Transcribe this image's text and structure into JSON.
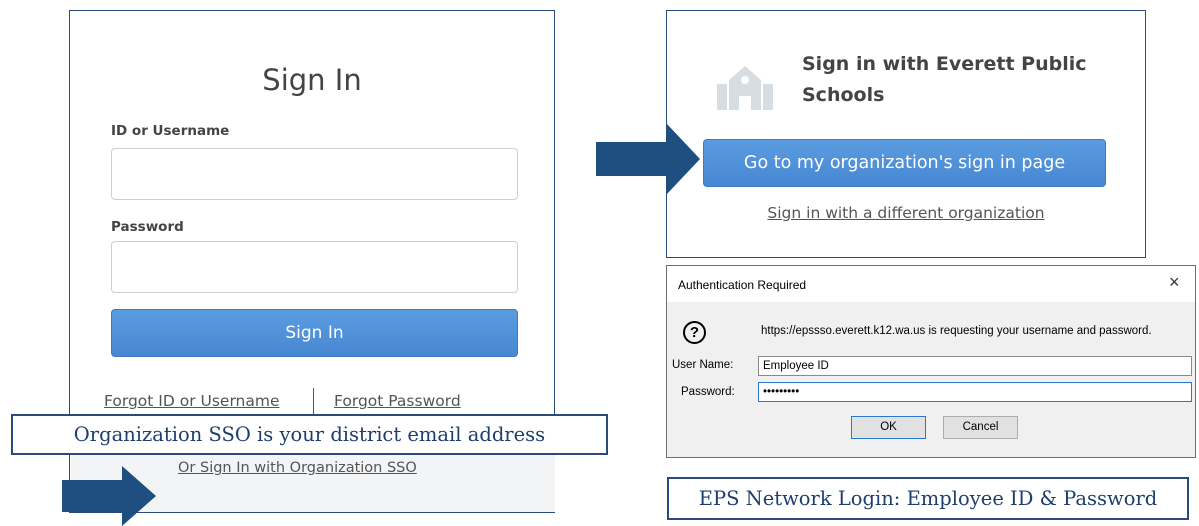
{
  "signin": {
    "title": "Sign In",
    "id_label": "ID or Username",
    "password_label": "Password",
    "button": "Sign In",
    "forgot_id": "Forgot ID or Username",
    "forgot_password": "Forgot Password",
    "sso_link": "Or Sign In with Organization SSO"
  },
  "callouts": {
    "sso": "Organization SSO is your district email address",
    "eps": "EPS Network Login: Employee ID & Password"
  },
  "org": {
    "title": "Sign in with Everett Public Schools",
    "button": "Go to my organization's sign in page",
    "different_org": "Sign in with a different organization"
  },
  "auth_dialog": {
    "title": "Authentication Required",
    "close": "×",
    "icon": "?",
    "message": "https://epssso.everett.k12.wa.us is requesting your username and password.",
    "user_label": "User Name:",
    "user_value": "Employee ID",
    "password_label": "Password:",
    "password_value": "•••••••••",
    "ok": "OK",
    "cancel": "Cancel"
  },
  "colors": {
    "accent_blue": "#4a8ad4",
    "border_navy": "#2a4a7b",
    "arrow": "#1f4e80"
  }
}
